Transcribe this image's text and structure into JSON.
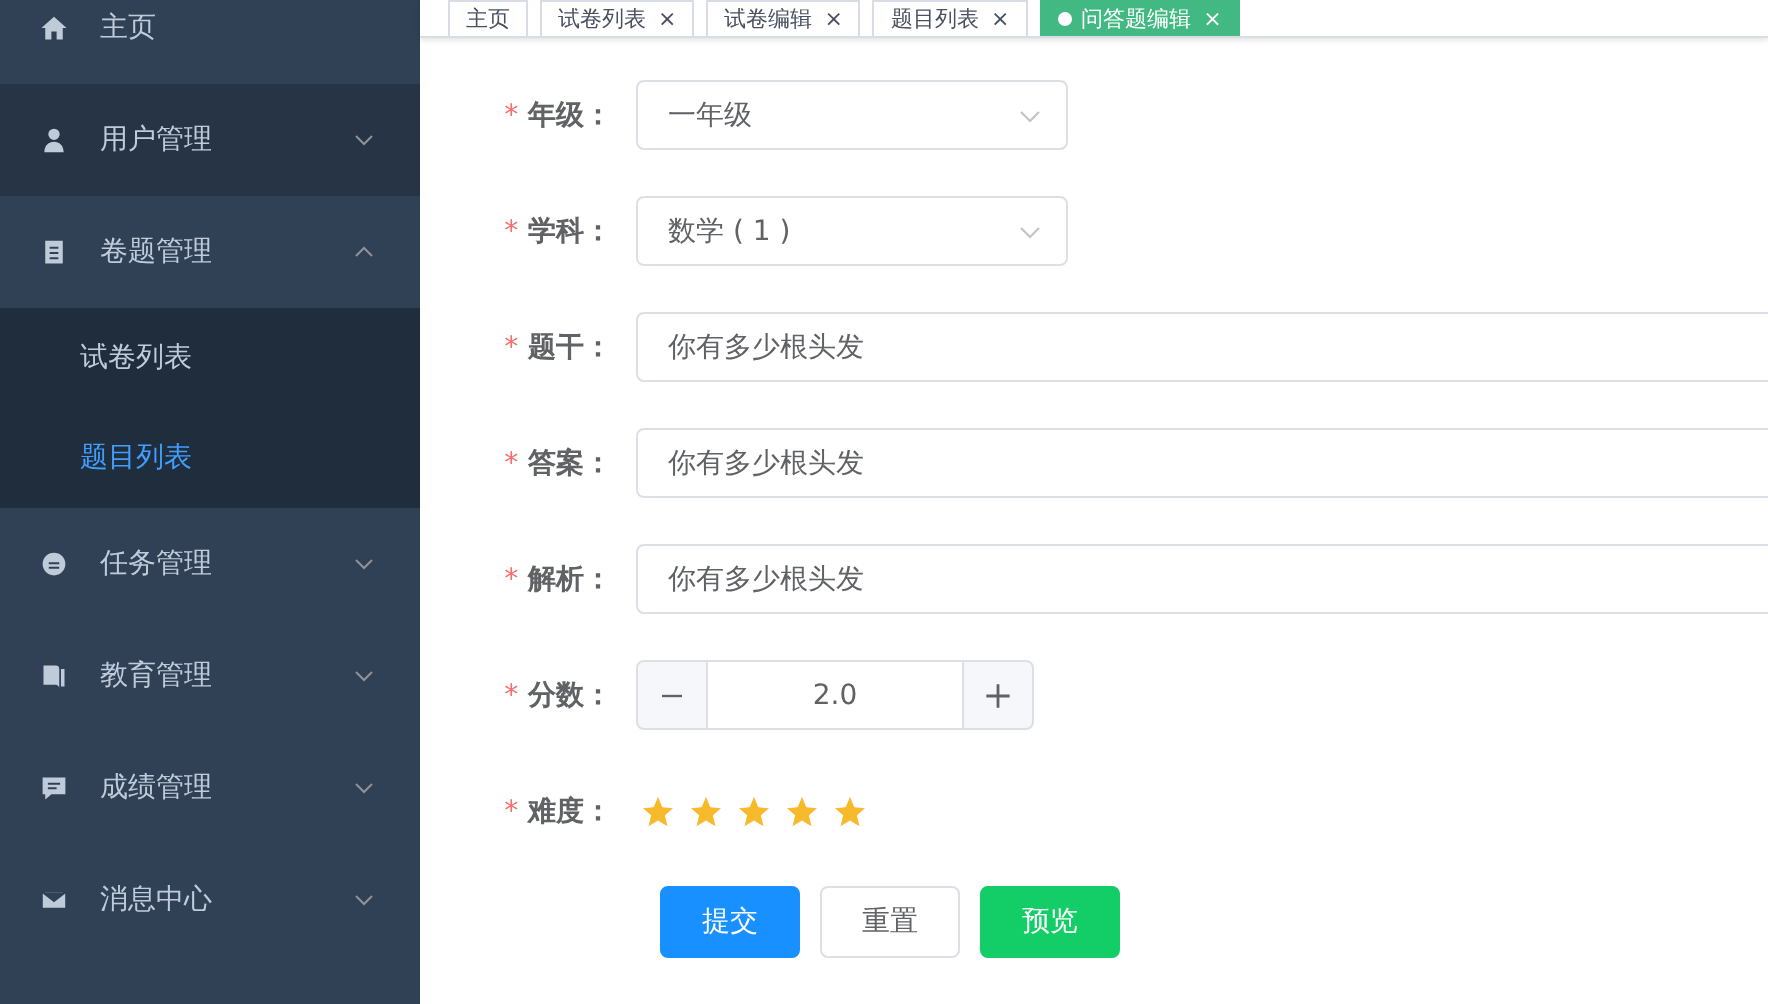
{
  "sidebar": {
    "items": [
      {
        "label": "主页",
        "selected": false,
        "hovered": false
      },
      {
        "label": "用户管理",
        "expanded": false,
        "selected": false,
        "hovered": true
      },
      {
        "label": "卷题管理",
        "expanded": true,
        "selected": false,
        "hovered": false,
        "children": [
          {
            "label": "试卷列表",
            "selected": false
          },
          {
            "label": "题目列表",
            "selected": true
          }
        ]
      },
      {
        "label": "任务管理",
        "expanded": false,
        "selected": false,
        "hovered": false
      },
      {
        "label": "教育管理",
        "expanded": false,
        "selected": false,
        "hovered": false
      },
      {
        "label": "成绩管理",
        "expanded": false,
        "selected": false,
        "hovered": false
      },
      {
        "label": "消息中心",
        "expanded": false,
        "selected": false,
        "hovered": false
      }
    ]
  },
  "tabs": [
    {
      "label": "主页",
      "closable": false,
      "selected": false
    },
    {
      "label": "试卷列表",
      "closable": true,
      "selected": false
    },
    {
      "label": "试卷编辑",
      "closable": true,
      "selected": false
    },
    {
      "label": "题目列表",
      "closable": true,
      "selected": false
    },
    {
      "label": "问答题编辑",
      "closable": true,
      "selected": true
    }
  ],
  "close_glyph": "×",
  "form": {
    "fields": [
      {
        "kind": "select",
        "label": "年级：",
        "required": true,
        "value": "一年级"
      },
      {
        "kind": "select",
        "label": "学科：",
        "required": true,
        "value": "数学 ( 1 )"
      },
      {
        "kind": "text",
        "label": "题干：",
        "required": true,
        "value": "你有多少根头发"
      },
      {
        "kind": "text",
        "label": "答案：",
        "required": true,
        "value": "你有多少根头发"
      },
      {
        "kind": "text",
        "label": "解析：",
        "required": true,
        "value": "你有多少根头发"
      },
      {
        "kind": "number",
        "label": "分数：",
        "required": true,
        "value": "2.0"
      },
      {
        "kind": "rate",
        "label": "难度：",
        "required": true,
        "stars": 5
      }
    ],
    "required_mark": "*",
    "buttons": [
      {
        "kind": "primary",
        "label": "提交"
      },
      {
        "kind": "plain",
        "label": "重置"
      },
      {
        "kind": "success",
        "label": "预览"
      }
    ]
  }
}
